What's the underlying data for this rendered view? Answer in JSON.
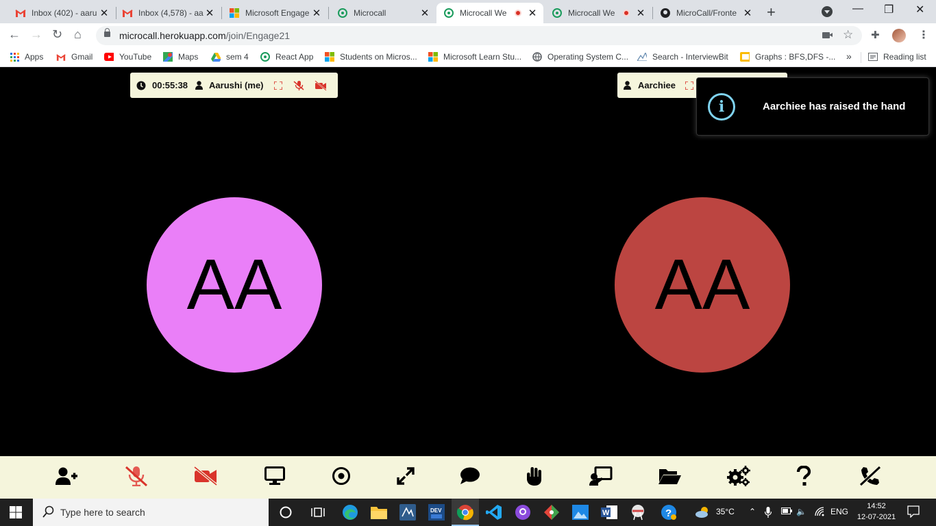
{
  "browser": {
    "tabs": [
      {
        "title": "Inbox (402) - aaru",
        "icon": "gmail-icon"
      },
      {
        "title": "Inbox (4,578) - aa",
        "icon": "gmail-icon"
      },
      {
        "title": "Microsoft Engage",
        "icon": "microsoft-icon"
      },
      {
        "title": "Microcall",
        "icon": "microcall-icon"
      },
      {
        "title": "Microcall We",
        "icon": "microcall-icon",
        "recording": true,
        "active": true
      },
      {
        "title": "Microcall We",
        "icon": "microcall-icon",
        "recording": true
      },
      {
        "title": "MicroCall/Fronte",
        "icon": "github-icon"
      }
    ],
    "url": {
      "host": "microcall.herokuapp.com",
      "path": "/join/Engage21"
    },
    "bookmarks": [
      {
        "label": "Apps",
        "icon": "apps-grid-icon"
      },
      {
        "label": "Gmail",
        "icon": "gmail-icon"
      },
      {
        "label": "YouTube",
        "icon": "youtube-icon"
      },
      {
        "label": "Maps",
        "icon": "maps-icon"
      },
      {
        "label": "sem 4",
        "icon": "drive-icon"
      },
      {
        "label": "React App",
        "icon": "microcall-icon"
      },
      {
        "label": "Students on Micros...",
        "icon": "microsoft-icon"
      },
      {
        "label": "Microsoft Learn Stu...",
        "icon": "microsoft-icon"
      },
      {
        "label": "Operating System C...",
        "icon": "globe-icon"
      },
      {
        "label": "Search - InterviewBit",
        "icon": "interviewbit-icon"
      },
      {
        "label": "Graphs : BFS,DFS -...",
        "icon": "folder-bookmark-icon"
      }
    ],
    "reading_list": "Reading list"
  },
  "meeting": {
    "local": {
      "timer": "00:55:38",
      "name": "Aarushi (me)",
      "initials": "AA",
      "avatar_color": "#ea7ff8"
    },
    "remote": {
      "name": "Aarchiee",
      "initials": "AA",
      "avatar_color": "#bc4541"
    },
    "toast": {
      "message": "Aarchiee has raised the hand",
      "icon": "info-icon"
    }
  },
  "controls": [
    {
      "name": "add-participant-button",
      "icon": "user-plus-icon"
    },
    {
      "name": "microphone-button",
      "icon": "microphone-slash-icon"
    },
    {
      "name": "camera-button",
      "icon": "video-slash-icon"
    },
    {
      "name": "share-screen-button",
      "icon": "desktop-icon"
    },
    {
      "name": "record-button",
      "icon": "record-icon"
    },
    {
      "name": "fullscreen-button",
      "icon": "expand-icon"
    },
    {
      "name": "chat-button",
      "icon": "comment-icon"
    },
    {
      "name": "raise-hand-button",
      "icon": "hand-icon"
    },
    {
      "name": "whiteboard-button",
      "icon": "chalkboard-teacher-icon"
    },
    {
      "name": "files-button",
      "icon": "folder-open-icon"
    },
    {
      "name": "settings-button",
      "icon": "cogs-icon"
    },
    {
      "name": "help-button",
      "icon": "question-icon"
    },
    {
      "name": "leave-call-button",
      "icon": "phone-slash-icon"
    }
  ],
  "colors": {
    "accent_red": "#d9342b",
    "controls_bg": "#f5f5dc",
    "toast_info": "#7fd3f0"
  },
  "taskbar": {
    "search_placeholder": "Type here to search",
    "weather": "35°C",
    "language": "ENG",
    "time": "14:52",
    "date": "12-07-2021"
  }
}
